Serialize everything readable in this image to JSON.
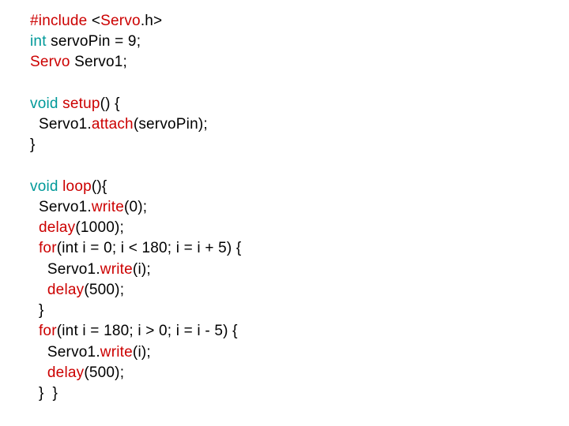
{
  "code": {
    "l1a": "#include",
    "l1b": " <",
    "l1c": "Servo",
    "l1d": ".h>",
    "l2a": "int",
    "l2b": " servoPin = 9;",
    "l3a": "Servo",
    "l3b": " Servo1;",
    "l4": "",
    "l5a": "void",
    "l5b": " setup",
    "l5c": "() {",
    "l6a": "  Servo1.",
    "l6b": "attach",
    "l6c": "(servoPin);",
    "l7": "}",
    "l8": "",
    "l9a": "void",
    "l9b": " loop",
    "l9c": "(){",
    "l10a": "  Servo1.",
    "l10b": "write",
    "l10c": "(0);",
    "l11a": "  delay",
    "l11b": "(1000);",
    "l12a": "  for",
    "l12b": "(int i = 0; i < 180; i = i + 5) {",
    "l13a": "    Servo1.",
    "l13b": "write",
    "l13c": "(i);",
    "l14a": "    delay",
    "l14b": "(500);",
    "l15": "  }",
    "l16a": "  for",
    "l16b": "(int i = 180; i > 0; i = i - 5) {",
    "l17a": "    Servo1.",
    "l17b": "write",
    "l17c": "(i);",
    "l18a": "    delay",
    "l18b": "(500);",
    "l19": "  }  }"
  }
}
